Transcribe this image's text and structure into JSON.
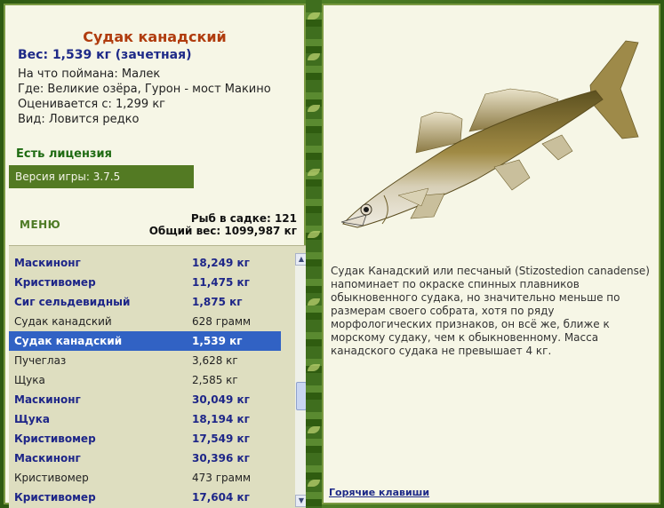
{
  "fish": {
    "title": "Судак канадский",
    "weight": "Вес: 1,539 кг (зачетная)",
    "bait": "На что поймана: Малек",
    "location": "Где: Великие озёра, Гурон - мост Макино",
    "value": "Оценивается с: 1,299 кг",
    "rarity": "Вид: Ловится редко"
  },
  "license": "Есть лицензия",
  "version": "Версия игры: 3.7.5",
  "menu_label": "МЕНЮ",
  "keep": {
    "count": "Рыб в садке: 121",
    "total": "Общий вес: 1099,987 кг"
  },
  "catch_list": [
    {
      "name": "Маскинонг",
      "weight": "18,249 кг",
      "style": "bold"
    },
    {
      "name": "Кристивомер",
      "weight": "11,475 кг",
      "style": "bold"
    },
    {
      "name": "Сиг сельдевидный",
      "weight": "1,875 кг",
      "style": "bold"
    },
    {
      "name": "Судак канадский",
      "weight": "628 грамм",
      "style": "plain"
    },
    {
      "name": "Судак канадский",
      "weight": "1,539 кг",
      "style": "selected"
    },
    {
      "name": "Пучеглаз",
      "weight": "3,628 кг",
      "style": "plain"
    },
    {
      "name": "Щука",
      "weight": "2,585 кг",
      "style": "plain"
    },
    {
      "name": "Маскинонг",
      "weight": "30,049 кг",
      "style": "bold"
    },
    {
      "name": "Щука",
      "weight": "18,194 кг",
      "style": "bold"
    },
    {
      "name": "Кристивомер",
      "weight": "17,549 кг",
      "style": "bold"
    },
    {
      "name": "Маскинонг",
      "weight": "30,396 кг",
      "style": "bold"
    },
    {
      "name": "Кристивомер",
      "weight": "473 грамм",
      "style": "plain"
    },
    {
      "name": "Кристивомер",
      "weight": "17,604 кг",
      "style": "bold"
    }
  ],
  "description": "Судак Канадский или песчаный (Stizostedion canadense) напоминает по окраске спинных плавников обыкновенного судака, но значительно меньше по размерам своего собрата, хотя по ряду морфологических признаков, он всё же, ближе к морскому судаку, чем к обыкновенному. Масса канадского судака не превышает 4 кг.",
  "hotkeys_label": "Горячие клавиши",
  "icons": {
    "scroll_up": "triangle-up",
    "scroll_down": "triangle-down"
  },
  "colors": {
    "frame_green": "#3d6a1c",
    "panel_bg": "#f6f6e6",
    "title_red": "#b03c0e",
    "weight_blue": "#1e2a88",
    "selection_blue": "#3162c4"
  }
}
